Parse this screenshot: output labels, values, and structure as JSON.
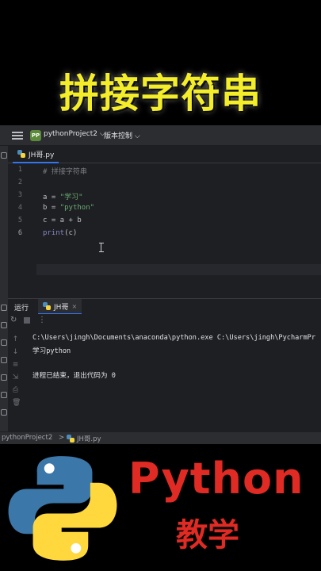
{
  "banner": {
    "title": "拼接字符串"
  },
  "titlebar": {
    "project_badge": "PP",
    "project_name": "pythonProject2 ⌵",
    "vcs_label": "版本控制 ⌵"
  },
  "editor_tab": {
    "filename": "JH哥.py"
  },
  "editor": {
    "line_numbers": [
      "1",
      "2",
      "3",
      "4",
      "5",
      "6"
    ],
    "lines": {
      "l1_comment": "# 拼接字符串",
      "l3_prefix": "a = ",
      "l3_str": "\"学习\"",
      "l4_prefix": "b = ",
      "l4_str": "\"python\"",
      "l5": "c = a + b",
      "l6_fn": "print",
      "l6_rest": "(c)"
    }
  },
  "run_panel": {
    "label": "运行",
    "tab_name": "JH哥",
    "tab_close": "×",
    "console": {
      "command": "C:\\Users\\jingh\\Documents\\anaconda\\python.exe C:\\Users\\jingh\\PycharmPr",
      "output": "学习python",
      "exit_message": "进程已结束，退出代码为 0"
    }
  },
  "statusbar": {
    "crumb_project": "pythonProject2",
    "separator": ">",
    "crumb_file": "JH哥.py"
  },
  "bottom": {
    "python_word": "Python",
    "subtitle": "教学"
  },
  "colors": {
    "banner_yellow": "#f4ee2a",
    "brand_red": "#e02a24",
    "ide_bg": "#1e1f22",
    "string_green": "#6aab73",
    "python_blue": "#3b77a8",
    "python_yellow": "#fed83d"
  }
}
